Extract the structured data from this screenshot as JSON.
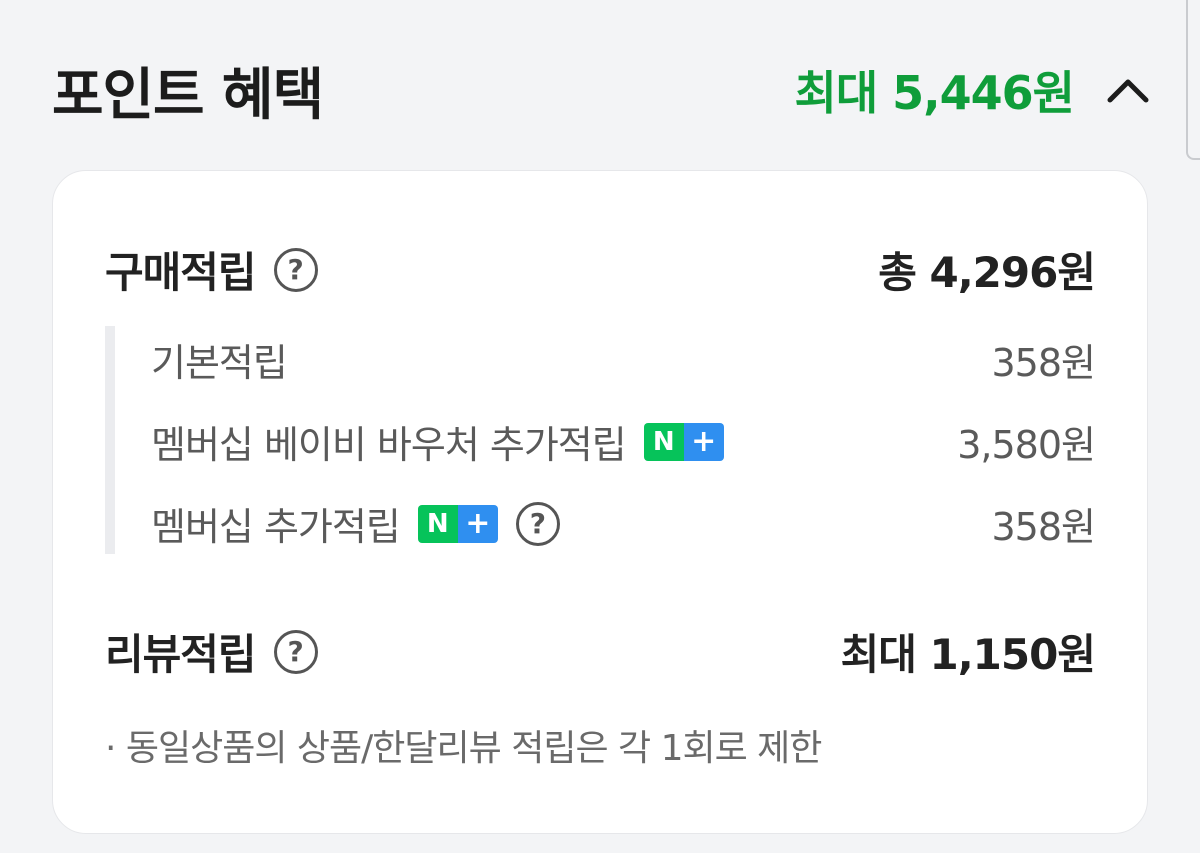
{
  "header": {
    "title": "포인트 혜택",
    "total": "최대 5,446원",
    "chevron_icon": "chevron-up-icon"
  },
  "purchase": {
    "title": "구매적립",
    "help_icon": "question-icon",
    "total": "총 4,296원",
    "items": [
      {
        "label": "기본적립",
        "value": "358원"
      },
      {
        "label": "멤버십 베이비 바우처 추가적립",
        "badge": "N+",
        "value": "3,580원"
      },
      {
        "label": "멤버십 추가적립",
        "badge": "N+",
        "help_icon": "question-icon",
        "value": "358원"
      }
    ]
  },
  "review": {
    "title": "리뷰적립",
    "help_icon": "question-icon",
    "total": "최대 1,150원",
    "note": "· 동일상품의 상품/한달리뷰 적립은 각 1회로 제한"
  },
  "badge": {
    "n": "N",
    "plus": "+"
  },
  "help_glyph": "?",
  "colors": {
    "accent": "#0f9d3a",
    "badge_n": "#06c35a",
    "badge_plus": "#2f8ff0",
    "background": "#f3f4f6"
  }
}
